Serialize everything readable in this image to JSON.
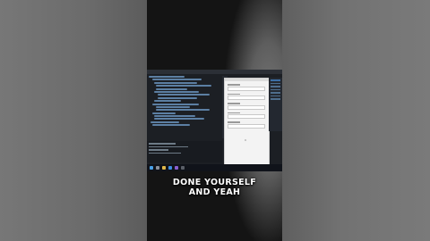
{
  "caption": {
    "line1": "DONE YOURSELF",
    "line2": "AND YEAH"
  },
  "colors": {
    "letterbox": "#6a6a6a",
    "video_bg": "#141414",
    "editor_bg": "#1c1f24",
    "app_window_bg": "#f3f3f3",
    "caption_text": "#ffffff"
  },
  "icons": [
    "windows-start-icon",
    "search-icon",
    "file-explorer-icon",
    "browser-icon",
    "visual-studio-icon",
    "terminal-icon"
  ]
}
